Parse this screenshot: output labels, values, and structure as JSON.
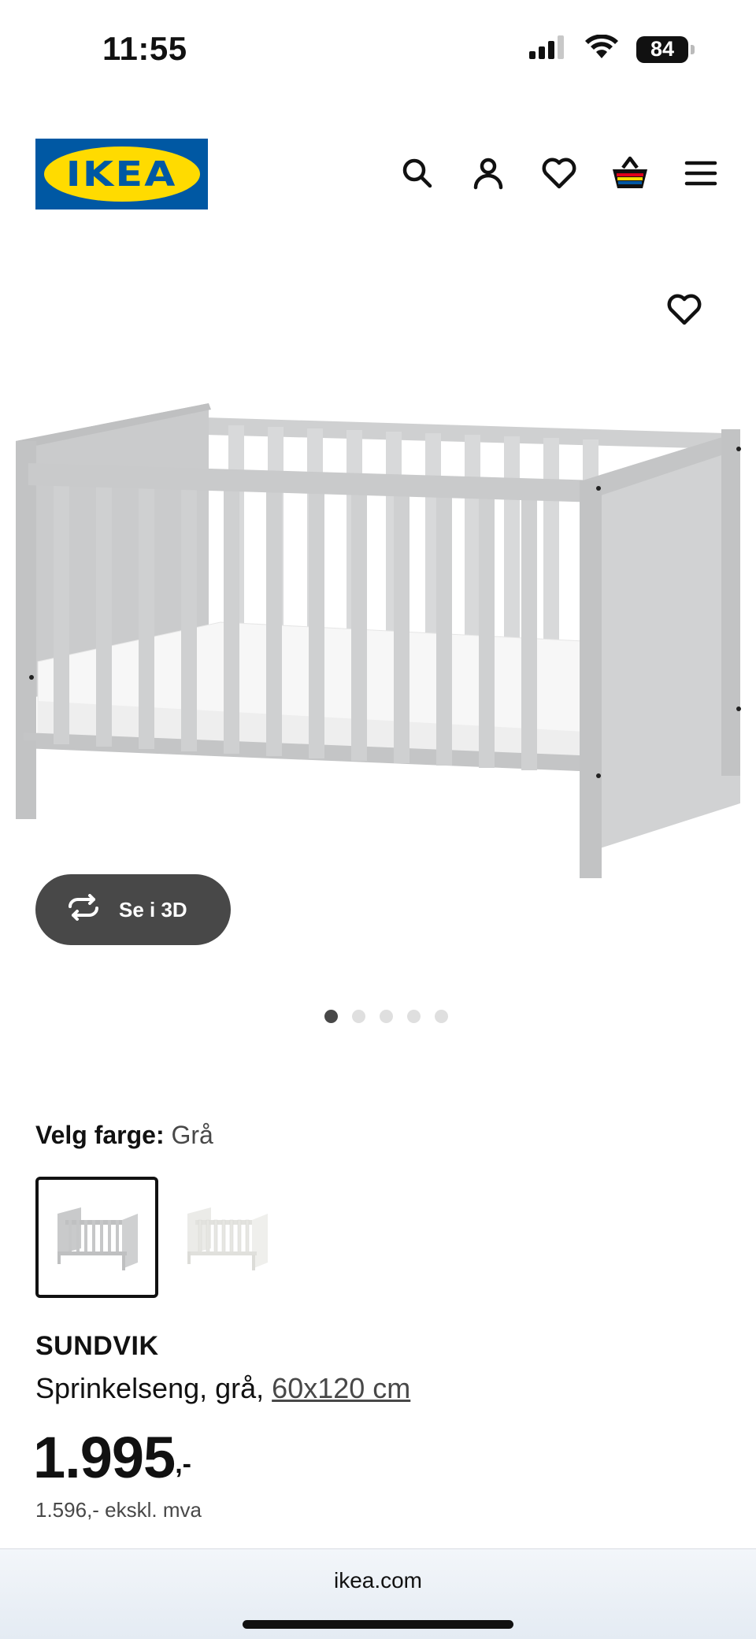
{
  "status_bar": {
    "time": "11:55",
    "battery": "84"
  },
  "header": {
    "logo_text": "IKEA",
    "icons": [
      "search-icon",
      "account-icon",
      "heart-icon",
      "basket-icon",
      "menu-icon"
    ]
  },
  "gallery": {
    "view_3d_label": "Se i 3D",
    "dots_total": 5,
    "active_dot": 1
  },
  "colors": {
    "label": "Velg farge:",
    "selected_value": "Grå",
    "swatches": [
      "Grå",
      "Hvit"
    ]
  },
  "product": {
    "name": "SUNDVIK",
    "description": "Sprinkelseng, grå, ",
    "size_link": "60x120 cm",
    "price": "1.995",
    "price_suffix": ",-",
    "price_ex_vat": "1.596,- ekskl. mva"
  },
  "browser": {
    "url": "ikea.com"
  },
  "theme": {
    "ikea_blue": "#0058a3",
    "ikea_yellow": "#ffdb00",
    "dark_button": "#484848"
  }
}
